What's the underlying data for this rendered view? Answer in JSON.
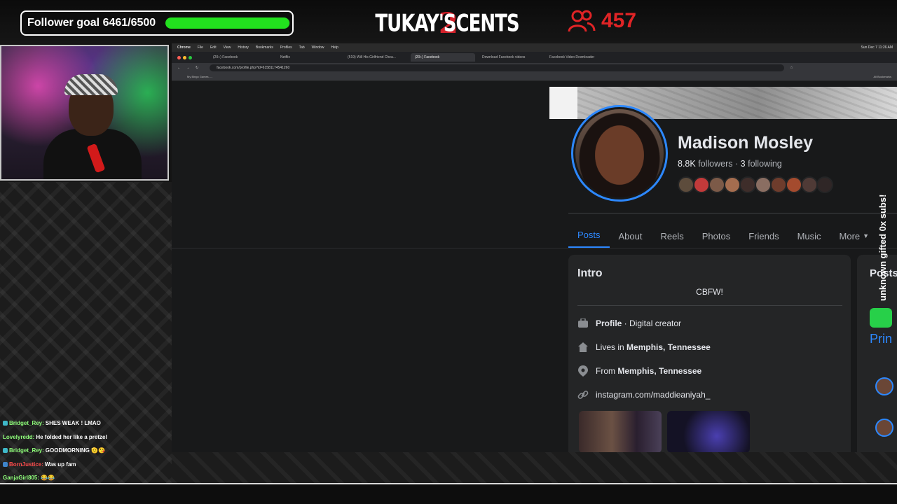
{
  "overlay": {
    "follower_goal_label": "Follower goal 6461/6500",
    "follower_goal_progress": 0.994,
    "logo_text": "TUKAY'S",
    "logo_two": "2",
    "logo_suffix": "CENTS",
    "viewer_count": "457",
    "viewer_icon": "users-icon",
    "sub_alert": "unknown gifted 0x subs!"
  },
  "chat": [
    {
      "user": "Bridget_Rey:",
      "message": "SHES WEAK ! LMAO",
      "badge_color": "#3fb8c9"
    },
    {
      "user": "Lovelyredd:",
      "message": "He folded her like a pretzel",
      "badge_color": ""
    },
    {
      "user": "Bridget_Rey:",
      "message": "GOODMORNING 🫡😘",
      "badge_color": "#3fb8c9"
    },
    {
      "user": "BornJustice:",
      "message": "Was up fam",
      "badge_color": "#3f84c9"
    },
    {
      "user": "GanjaGirl805:",
      "message": "😂😂",
      "badge_color": ""
    }
  ],
  "browser": {
    "menubar": [
      "Chrome",
      "File",
      "Edit",
      "View",
      "History",
      "Bookmarks",
      "Profiles",
      "Tab",
      "Window",
      "Help"
    ],
    "clock": "Sun Dec 7 11:26 AM",
    "tabs": [
      {
        "label": "(20+) Facebook",
        "active": false
      },
      {
        "label": "Netflix",
        "active": false
      },
      {
        "label": "(519) Will His Girlfriend Chea...",
        "active": false
      },
      {
        "label": "(20+) Facebook",
        "active": true
      },
      {
        "label": "Download Facebook videos",
        "active": false
      },
      {
        "label": "Facebook Video Downloader",
        "active": false
      }
    ],
    "url": "facebook.com/profile.php?id=61581174541260",
    "bookmark": "My Bingo Games -...",
    "all_bookmarks": "All Bookmarks"
  },
  "profile": {
    "name": "Madison Mosley",
    "followers_count": "8.8K",
    "followers_label": "followers",
    "following_count": "3",
    "following_label": "following",
    "tabs": [
      "Posts",
      "About",
      "Reels",
      "Photos",
      "Friends",
      "Music",
      "More"
    ],
    "active_tab": "Posts",
    "intro": {
      "title": "Intro",
      "bio": "CBFW!",
      "profile_label": "Profile",
      "profile_category": " · Digital creator",
      "lives_prefix": "Lives in ",
      "lives_city": "Memphis, Tennessee",
      "from_prefix": "From ",
      "from_city": "Memphis, Tennessee",
      "link": "instagram.com/maddieaniyah_"
    },
    "posts_title": "Posts",
    "posts_print": "Prin"
  },
  "colors": {
    "accent": "#2d88ff",
    "goal_fill": "#22e01e",
    "viewer_red": "#e02426"
  }
}
